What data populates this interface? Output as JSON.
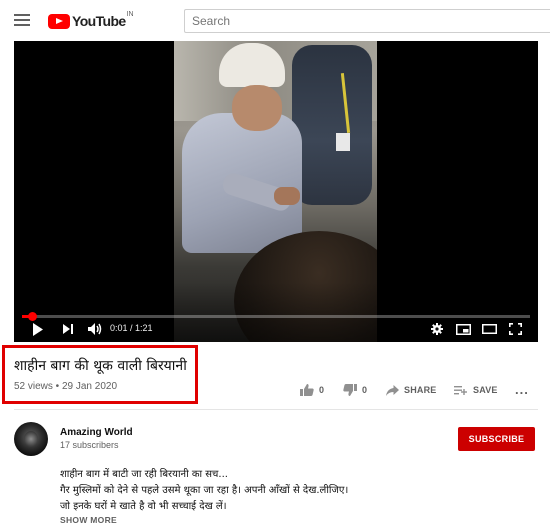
{
  "header": {
    "logo_text": "YouTube",
    "logo_country": "IN",
    "search_placeholder": "Search"
  },
  "player": {
    "time_display": "0:01 / 1:21",
    "progress_fraction": 0.02
  },
  "video": {
    "title": "शाहीन बाग की थूक वाली बिरयानी",
    "views": "52 views",
    "date": "29 Jan 2020",
    "meta_separator": " • ",
    "likes": "0",
    "dislikes": "0",
    "share_label": "SHARE",
    "save_label": "SAVE",
    "more_label": "..."
  },
  "channel": {
    "name": "Amazing World",
    "subscribers": "17 subscribers",
    "subscribe_label": "SUBSCRIBE"
  },
  "description": {
    "lines": [
      "शाहीन बाग में बाटी जा रही बिरयानी का सच...",
      "गैर मुस्लिमों को देने से पहले उसमे थूका जा रहा है। अपनी आँखों से देख.लीजिए।",
      "जो इनके घरों मे खाते है वो भी सच्चाई देख लें।"
    ],
    "show_more": "SHOW MORE"
  },
  "colors": {
    "brand_red": "#ff0000",
    "subscribe_red": "#cc0000",
    "highlight_box": "#e00000"
  }
}
